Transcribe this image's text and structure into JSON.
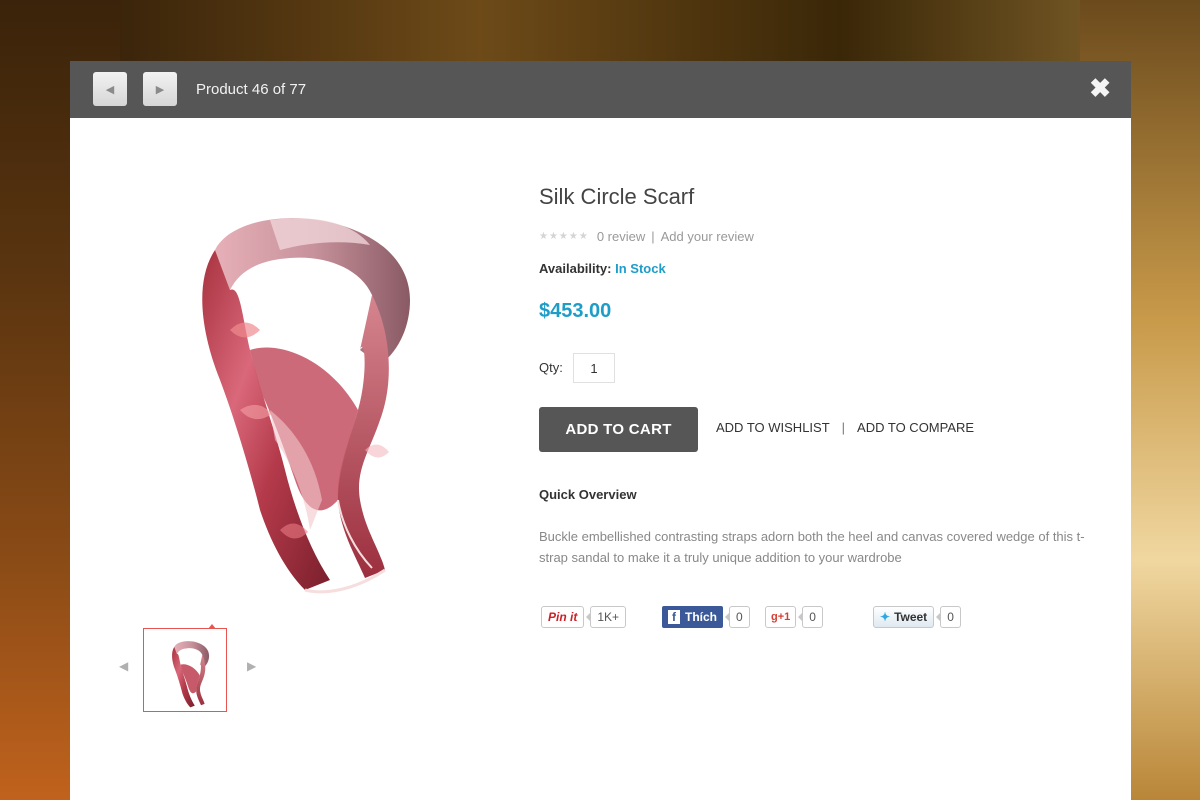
{
  "nav": {
    "prev_icon": "chevron-left-icon",
    "next_icon": "chevron-right-icon",
    "counter": "Product 46 of 77",
    "close": "✖"
  },
  "product": {
    "title": "Silk Circle Scarf",
    "stars": "★★★★★",
    "review_count": "0 review",
    "add_review": "Add your review",
    "availability_label": "Availability:",
    "availability_value": "In Stock",
    "price": "$453.00",
    "qty_label": "Qty:",
    "qty_value": "1",
    "add_to_cart": "ADD TO CART",
    "add_to_wishlist": "ADD TO WISHLIST",
    "add_to_compare": "ADD TO COMPARE",
    "overview_title": "Quick Overview",
    "overview_text": "Buckle embellished contrasting straps adorn both the heel and canvas covered wedge of this t-strap sandal to make it a truly unique addition to your wardrobe"
  },
  "social": {
    "pinit_label": "Pin it",
    "pinit_count": "1K+",
    "facebook_label": "Thích",
    "facebook_count": "0",
    "gplus_label": "+1",
    "gplus_count": "0",
    "tweet_label": "Tweet",
    "tweet_count": "0"
  },
  "colors": {
    "accent": "#1e9dc9",
    "topbar": "#565656",
    "thumb_border": "#e9544f"
  }
}
